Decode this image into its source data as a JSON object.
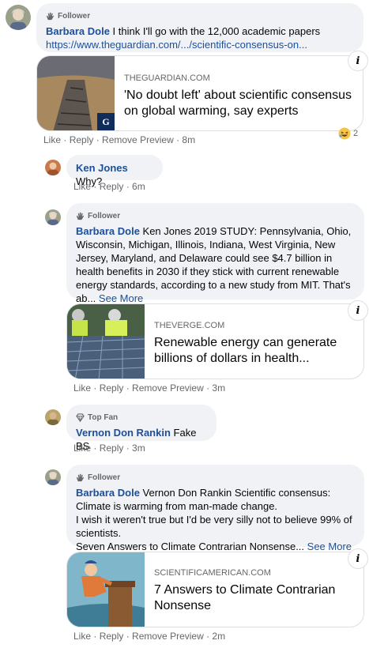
{
  "comments": [
    {
      "badge": "Follower",
      "author": "Barbara Dole",
      "text": " I think I'll go with the 12,000 academic papers",
      "link": "https://www.theguardian.com/.../scientific-consensus-on...",
      "card": {
        "domain": "THEGUARDIAN.COM",
        "headline": "'No doubt left' about scientific consensus on global warming, say experts"
      },
      "actions": {
        "like": "Like",
        "reply": "Reply",
        "remove": "Remove Preview",
        "time": "8m"
      },
      "reaction_count": "2"
    },
    {
      "author": "Ken Jones",
      "text": " Why?",
      "actions": {
        "like": "Like",
        "reply": "Reply",
        "time": "6m"
      }
    },
    {
      "badge": "Follower",
      "author": "Barbara Dole",
      "text": " Ken Jones 2019 STUDY: Pennsylvania, Ohio, Wisconsin, Michigan, Illinois, Indiana, West Virginia, New Jersey, Maryland, and Delaware could see $4.7 billion in health benefits in 2030 if they stick with current renewable energy standards, according to a new study from MIT. That's ab...",
      "see_more": "See More",
      "card": {
        "domain": "THEVERGE.COM",
        "headline": "Renewable energy can generate billions of dollars in health..."
      },
      "actions": {
        "like": "Like",
        "reply": "Reply",
        "remove": "Remove Preview",
        "time": "3m"
      }
    },
    {
      "badge": "Top Fan",
      "author": "Vernon Don Rankin",
      "text": " Fake BS",
      "actions": {
        "like": "Like",
        "reply": "Reply",
        "time": "3m"
      }
    },
    {
      "badge": "Follower",
      "author": "Barbara Dole",
      "text_lines": [
        " Vernon Don Rankin Scientific consensus: Climate is warming from man-made change.",
        "I wish it weren't true but I'd be very silly not to believe 99% of scientists.",
        "Seven Answers to Climate Contrarian Nonsense..."
      ],
      "see_more": "See More",
      "card": {
        "domain": "SCIENTIFICAMERICAN.COM",
        "headline": "7 Answers to Climate Contrarian Nonsense"
      },
      "actions": {
        "like": "Like",
        "reply": "Reply",
        "remove": "Remove Preview",
        "time": "2m"
      }
    }
  ],
  "sep": " · ",
  "info_glyph": "i",
  "icons": {
    "follower": "waving-hand-icon",
    "top_fan": "diamond-icon",
    "reaction": "laughing-emoji-icon"
  },
  "colors": {
    "name": "#1b4f9c",
    "bubble": "#f0f2f5",
    "meta": "#65676b"
  }
}
